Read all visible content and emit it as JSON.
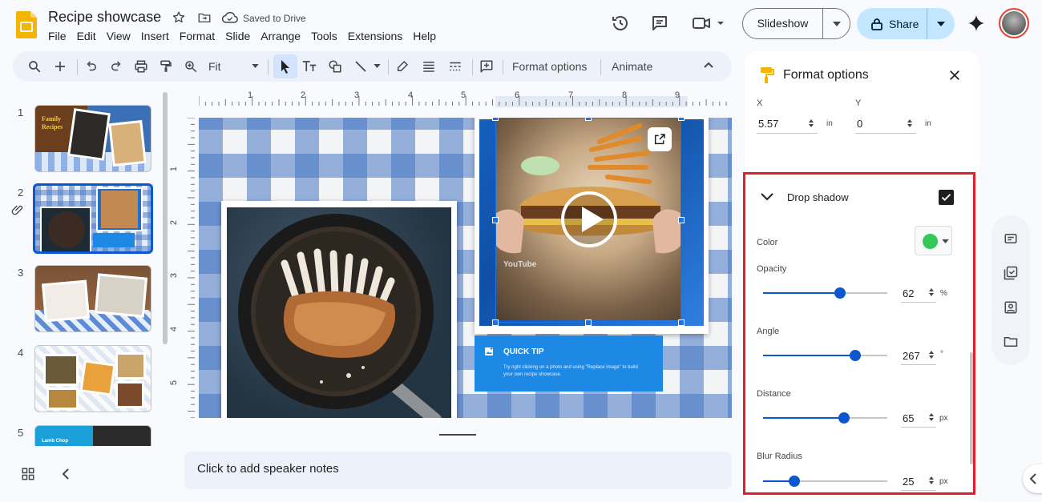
{
  "header": {
    "title": "Recipe showcase",
    "save_status": "Saved to Drive",
    "menu": [
      "File",
      "Edit",
      "View",
      "Insert",
      "Format",
      "Slide",
      "Arrange",
      "Tools",
      "Extensions",
      "Help"
    ],
    "slideshow_label": "Slideshow",
    "share_label": "Share"
  },
  "toolbar": {
    "zoom": "Fit",
    "format_options": "Format options",
    "animate": "Animate"
  },
  "filmstrip": {
    "slides": [
      {
        "number": "1",
        "title": "Family Recipes"
      },
      {
        "number": "2"
      },
      {
        "number": "3"
      },
      {
        "number": "4"
      },
      {
        "number": "5",
        "title": "Lamb Chop"
      }
    ]
  },
  "slide": {
    "quick_tip_title": "QUICK TIP",
    "quick_tip_body": "Try right clicking on a photo and using \"Replace image\" to build your own recipe showcase.",
    "video_channel": "YouTube"
  },
  "ruler": {
    "h_ticks": [
      "1",
      "2",
      "3",
      "4",
      "5",
      "6",
      "7",
      "8",
      "9"
    ],
    "v_ticks": [
      "1",
      "2",
      "3",
      "4",
      "5"
    ]
  },
  "speaker_notes_placeholder": "Click to add speaker notes",
  "format_panel": {
    "title": "Format options",
    "position": {
      "x_label": "X",
      "x_value": "5.57",
      "x_unit": "in",
      "y_label": "Y",
      "y_value": "0",
      "y_unit": "in"
    },
    "drop_shadow": {
      "label": "Drop shadow",
      "enabled": true,
      "color_label": "Color",
      "color": "#34c759",
      "opacity_label": "Opacity",
      "opacity": "62",
      "opacity_unit": "%",
      "angle_label": "Angle",
      "angle": "267",
      "angle_unit": "°",
      "distance_label": "Distance",
      "distance": "65",
      "distance_unit": "px",
      "blur_label": "Blur Radius",
      "blur": "25",
      "blur_unit": "px"
    },
    "slider_fractions": {
      "opacity": 0.62,
      "angle": 0.74,
      "distance": 0.65,
      "blur": 0.25
    }
  },
  "colors": {
    "accent": "#0b57d0",
    "share_bg": "#c2e7ff",
    "highlight": "#e01f2a",
    "quick_tip_bg": "#1e88e5"
  }
}
